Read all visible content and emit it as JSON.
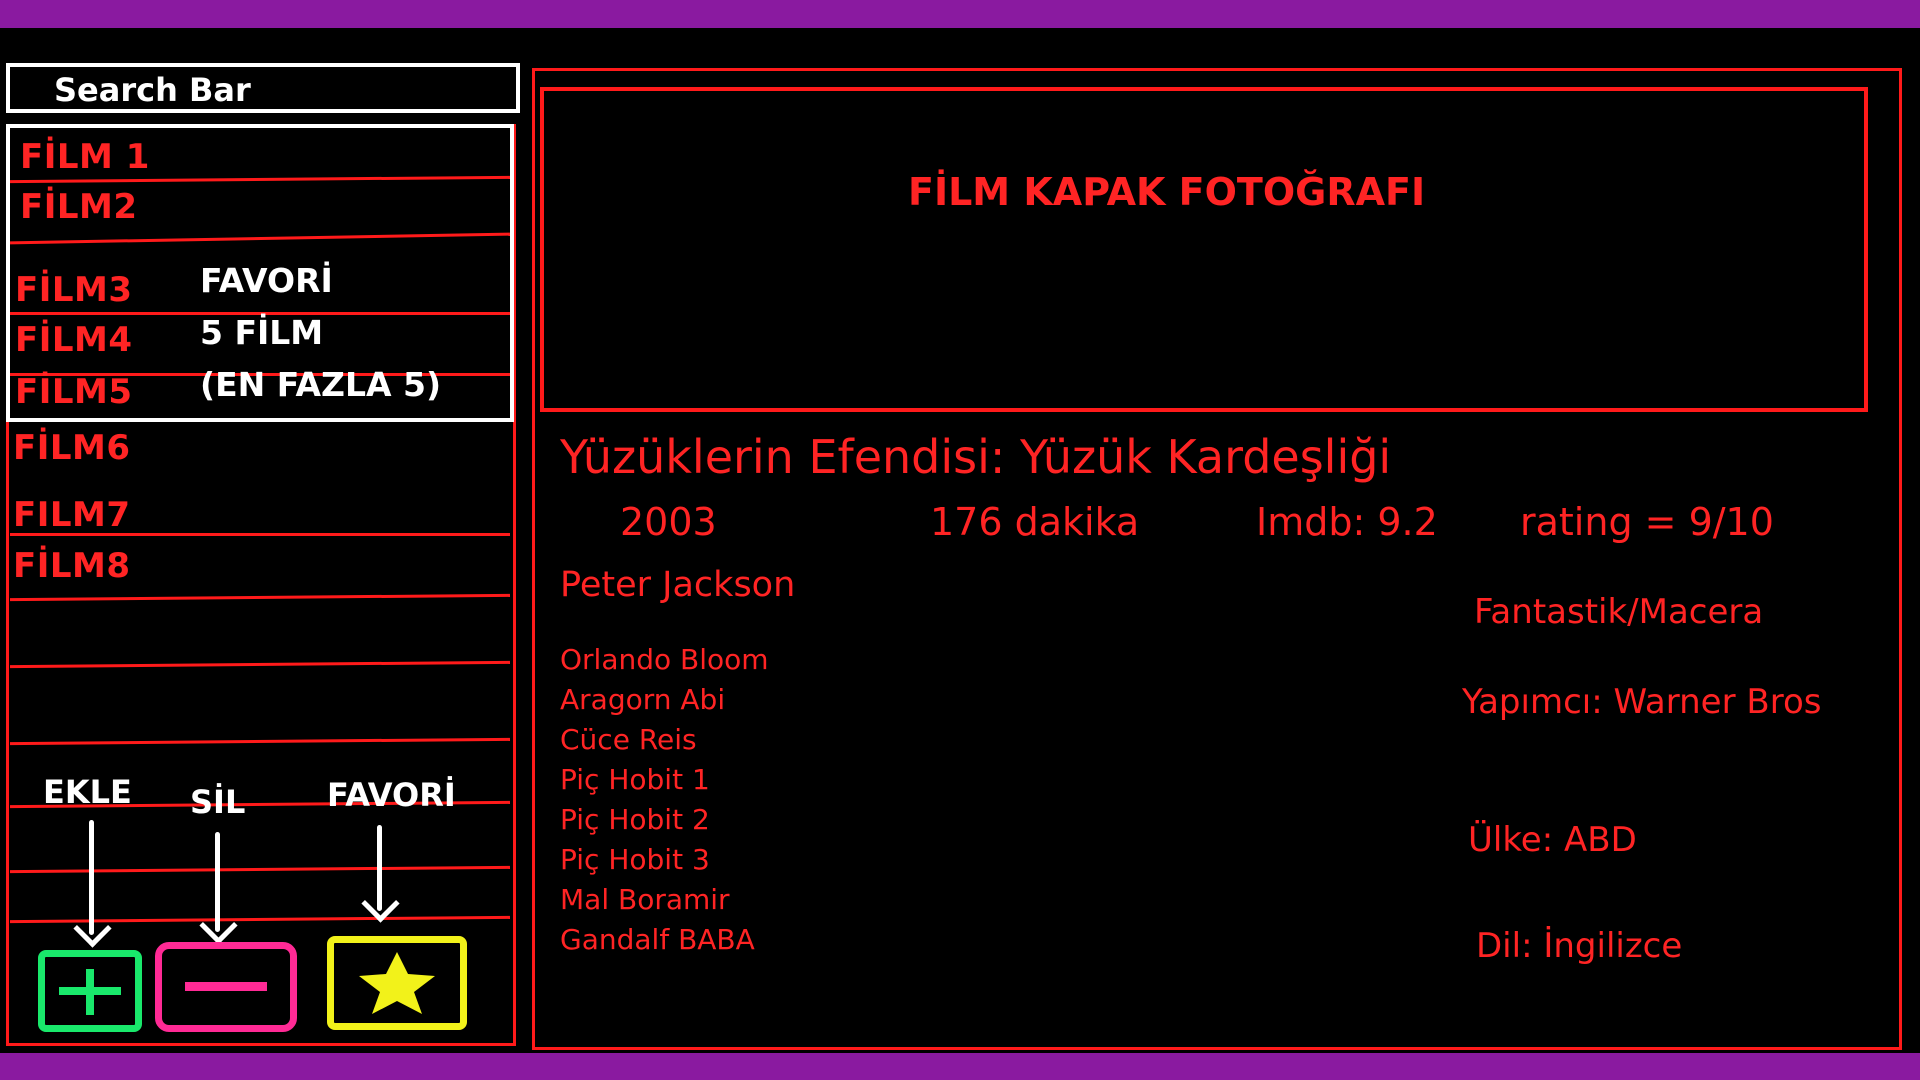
{
  "search": {
    "label": "Search Bar"
  },
  "films": [
    "FİLM 1",
    "FİLM2",
    "FİLM3",
    "FİLM4",
    "FİLM5",
    "FİLM6",
    "FILM7",
    "FİLM8"
  ],
  "favorites": {
    "line1": "FAVORİ",
    "line2": "5 FİLM",
    "line3": "(EN FAZLA 5)"
  },
  "actions": {
    "add_label": "EKLE",
    "delete_label": "SİL",
    "favorite_label": "FAVORİ"
  },
  "cover": {
    "label": "FİLM KAPAK FOTOĞRAFI"
  },
  "movie": {
    "title": "Yüzüklerin Efendisi: Yüzük Kardeşliği",
    "year": "2003",
    "duration": "176 dakika",
    "imdb": "Imdb: 9.2",
    "rating": "rating = 9/10",
    "director": "Peter Jackson",
    "genre": "Fantastik/Macera",
    "producer": "Yapımcı: Warner Bros",
    "country": "Ülke: ABD",
    "language": "Dil: İngilizce",
    "cast": [
      "Orlando Bloom",
      "Aragorn Abi",
      "Cüce Reis",
      "Piç Hobit 1",
      "Piç Hobit 2",
      "Piç Hobit 3",
      "Mal Boramir",
      "Gandalf BABA"
    ]
  },
  "colors": {
    "frame": "#ff1a1a",
    "text": "#ff2424",
    "bar": "#8a1aa0",
    "add": "#19e86b",
    "delete": "#ff2a95",
    "favorite": "#f2f21a"
  }
}
